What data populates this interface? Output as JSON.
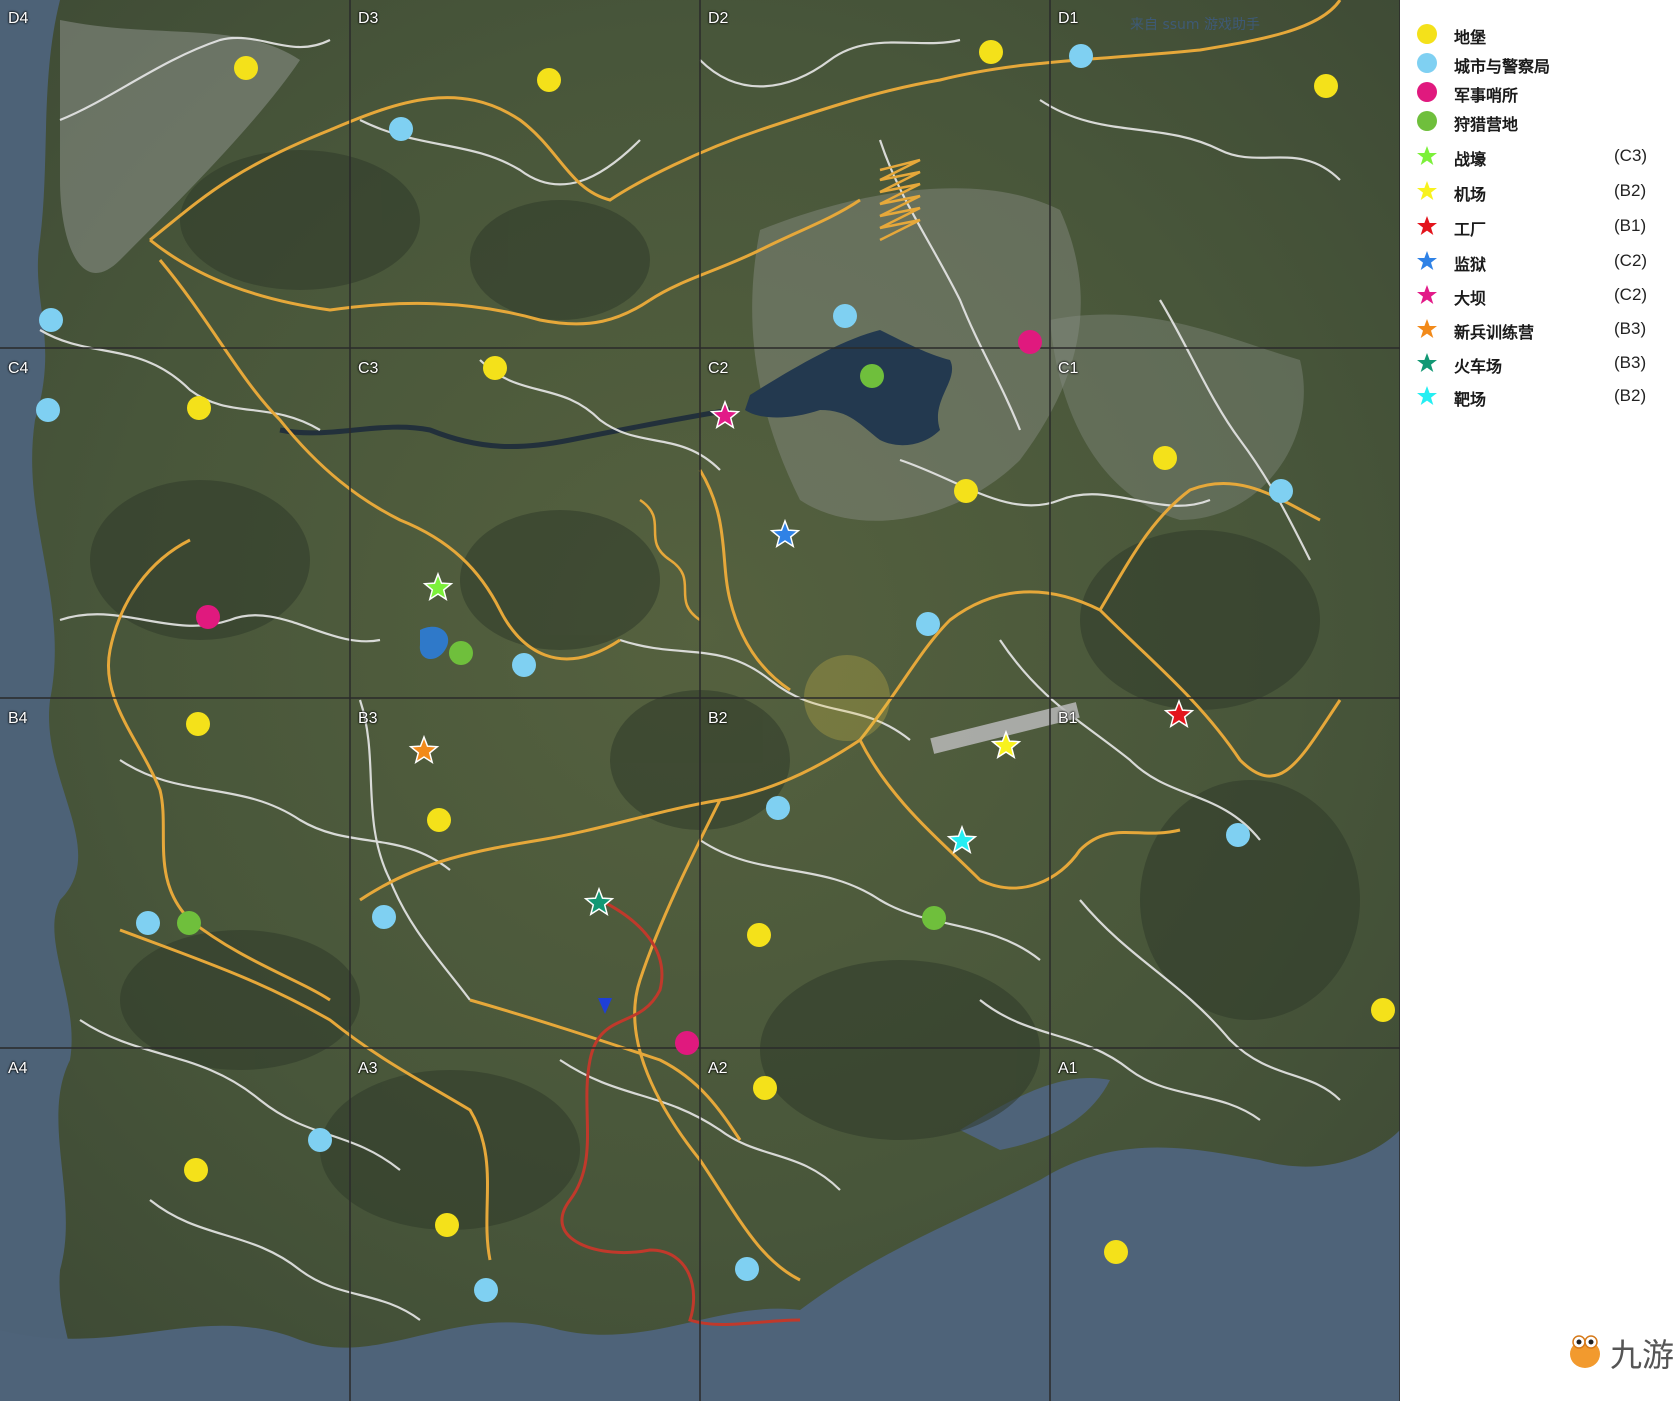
{
  "colors": {
    "castle": "#f4e11a",
    "city_police": "#7fd0f2",
    "military": "#e0197e",
    "hunting": "#6fbf3c",
    "trench": "#7cf03a",
    "airport": "#f8f21e",
    "factory": "#e3141c",
    "prison": "#2f82e6",
    "dam": "#e21a88",
    "recruit_camp": "#f28a1a",
    "rail_yard": "#129874",
    "shooting_range": "#25eef2",
    "road_main": "#e6a83a",
    "road_minor": "#e8e8e8",
    "grid_line": "#2a2a2a",
    "railway": "#c0392b"
  },
  "grid": {
    "cells": [
      {
        "id": "D4"
      },
      {
        "id": "D3"
      },
      {
        "id": "D2"
      },
      {
        "id": "D1"
      },
      {
        "id": "C4"
      },
      {
        "id": "C3"
      },
      {
        "id": "C2"
      },
      {
        "id": "C1"
      },
      {
        "id": "B4"
      },
      {
        "id": "B3"
      },
      {
        "id": "B2"
      },
      {
        "id": "B1"
      },
      {
        "id": "A4"
      },
      {
        "id": "A3"
      },
      {
        "id": "A2"
      },
      {
        "id": "A1"
      }
    ]
  },
  "legend": {
    "items": [
      {
        "key": "castle",
        "label": "地堡",
        "shape": "circle",
        "grid": ""
      },
      {
        "key": "city_police",
        "label": "城市与警察局",
        "shape": "circle",
        "grid": ""
      },
      {
        "key": "military",
        "label": "军事哨所",
        "shape": "circle",
        "grid": ""
      },
      {
        "key": "hunting",
        "label": "狩猎营地",
        "shape": "circle",
        "grid": ""
      },
      {
        "key": "trench",
        "label": "战壕",
        "shape": "star",
        "grid": "(C3)"
      },
      {
        "key": "airport",
        "label": "机场",
        "shape": "star",
        "grid": "(B2)"
      },
      {
        "key": "factory",
        "label": "工厂",
        "shape": "star",
        "grid": "(B1)"
      },
      {
        "key": "prison",
        "label": "监狱",
        "shape": "star",
        "grid": "(C2)"
      },
      {
        "key": "dam",
        "label": "大坝",
        "shape": "star",
        "grid": "(C2)"
      },
      {
        "key": "recruit_camp",
        "label": "新兵训练营",
        "shape": "star",
        "grid": "(B3)"
      },
      {
        "key": "rail_yard",
        "label": "火车场",
        "shape": "star",
        "grid": "(B3)"
      },
      {
        "key": "shooting_range",
        "label": "靶场",
        "shape": "star",
        "grid": "(B2)"
      }
    ]
  },
  "markers": {
    "castle": [
      {
        "cell": "D4"
      },
      {
        "cell": "D3"
      },
      {
        "cell": "D2"
      },
      {
        "cell": "D1"
      },
      {
        "cell": "C4"
      },
      {
        "cell": "C3"
      },
      {
        "cell": "C1"
      },
      {
        "cell": "C1"
      },
      {
        "cell": "B4"
      },
      {
        "cell": "B3"
      },
      {
        "cell": "B2"
      },
      {
        "cell": "B1"
      },
      {
        "cell": "A4"
      },
      {
        "cell": "A3"
      },
      {
        "cell": "A2"
      },
      {
        "cell": "A1"
      }
    ],
    "city_police": [
      {
        "cell": "D3"
      },
      {
        "cell": "D1"
      },
      {
        "cell": "D4"
      },
      {
        "cell": "D2"
      },
      {
        "cell": "C4"
      },
      {
        "cell": "C3"
      },
      {
        "cell": "C2"
      },
      {
        "cell": "C1"
      },
      {
        "cell": "B2"
      },
      {
        "cell": "B1"
      },
      {
        "cell": "B4"
      },
      {
        "cell": "B3"
      },
      {
        "cell": "A4"
      },
      {
        "cell": "A3"
      },
      {
        "cell": "A2"
      }
    ],
    "military": [
      {
        "cell": "C4"
      },
      {
        "cell": "D1"
      },
      {
        "cell": "A2"
      }
    ],
    "hunting": [
      {
        "cell": "C2"
      },
      {
        "cell": "C3"
      },
      {
        "cell": "B4"
      },
      {
        "cell": "B2"
      }
    ]
  },
  "watermark": {
    "brand": "九游",
    "faint_text": "来自 ssum 游戏助手"
  }
}
